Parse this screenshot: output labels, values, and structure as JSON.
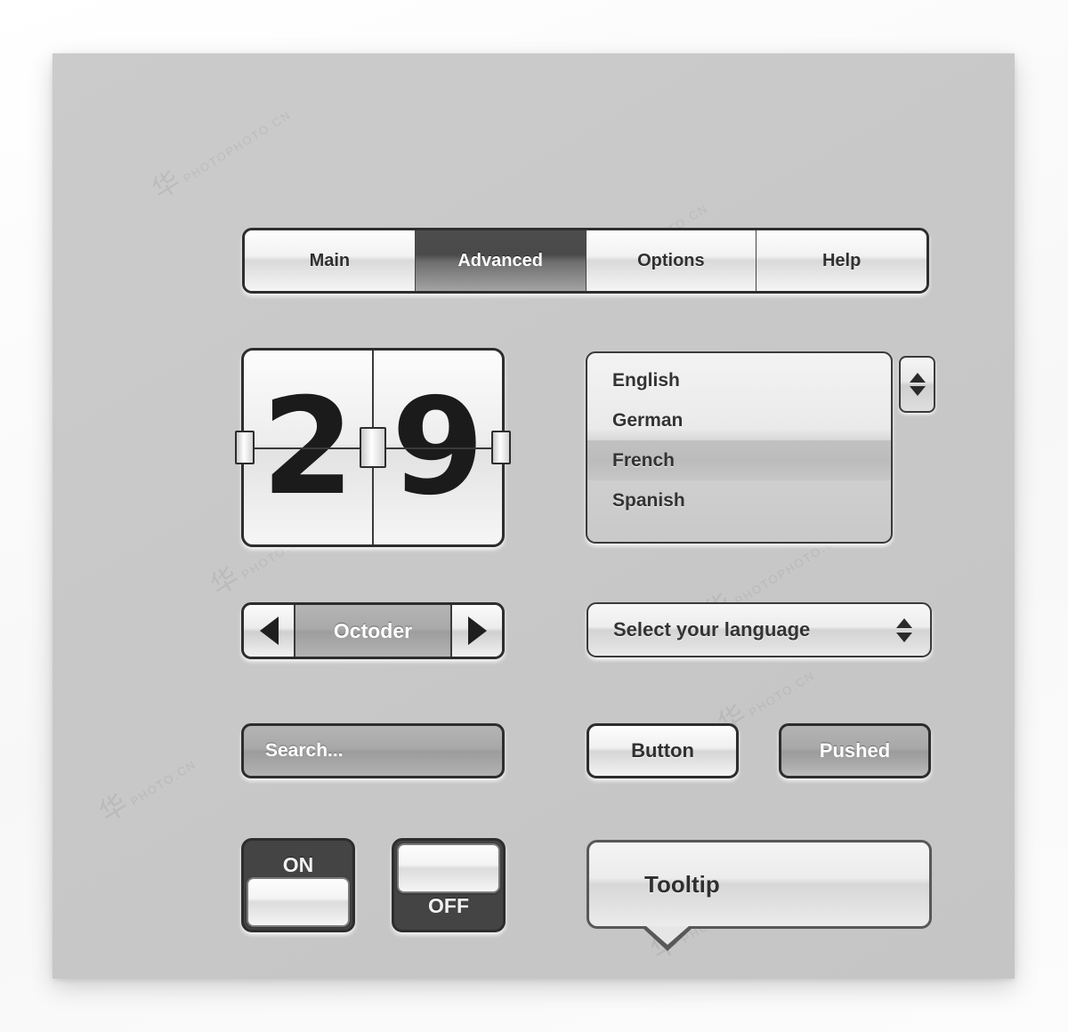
{
  "panel": {
    "background_color": "#c8c8c8",
    "page_background": "#fbfbfb"
  },
  "watermarks": [
    {
      "text": "PHOTOPHOTO.CN",
      "glyph": "华"
    },
    {
      "text": "PHOTO.CN",
      "glyph": "华"
    }
  ],
  "tabs": {
    "items": [
      {
        "label": "Main",
        "active": false
      },
      {
        "label": "Advanced",
        "active": true
      },
      {
        "label": "Options",
        "active": false
      },
      {
        "label": "Help",
        "active": false
      }
    ],
    "active_color": "#4a4a4a",
    "inactive_color": "#f0f0f0"
  },
  "flip_counter": {
    "digits": [
      "2",
      "9"
    ],
    "value": "29"
  },
  "list_box": {
    "items": [
      {
        "label": "English",
        "selected": false
      },
      {
        "label": "German",
        "selected": false
      },
      {
        "label": "French",
        "selected": true
      },
      {
        "label": "Spanish",
        "selected": false
      }
    ],
    "selected_value": "French",
    "spinner": {
      "up": "▲",
      "down": "▼"
    }
  },
  "stepper": {
    "value": "Octoder",
    "prev_icon": "◀",
    "next_icon": "▶"
  },
  "select": {
    "value": "Select your language",
    "up_icon": "▲",
    "down_icon": "▼"
  },
  "search": {
    "value": "",
    "placeholder": "Search...",
    "button_icon": "search-icon"
  },
  "buttons": {
    "normal_label": "Button",
    "pushed_label": "Pushed"
  },
  "toggles": [
    {
      "name": "toggle-on",
      "label": "ON",
      "state": "on"
    },
    {
      "name": "toggle-off",
      "label": "OFF",
      "state": "off"
    }
  ],
  "tooltip": {
    "text": "Tooltip"
  }
}
